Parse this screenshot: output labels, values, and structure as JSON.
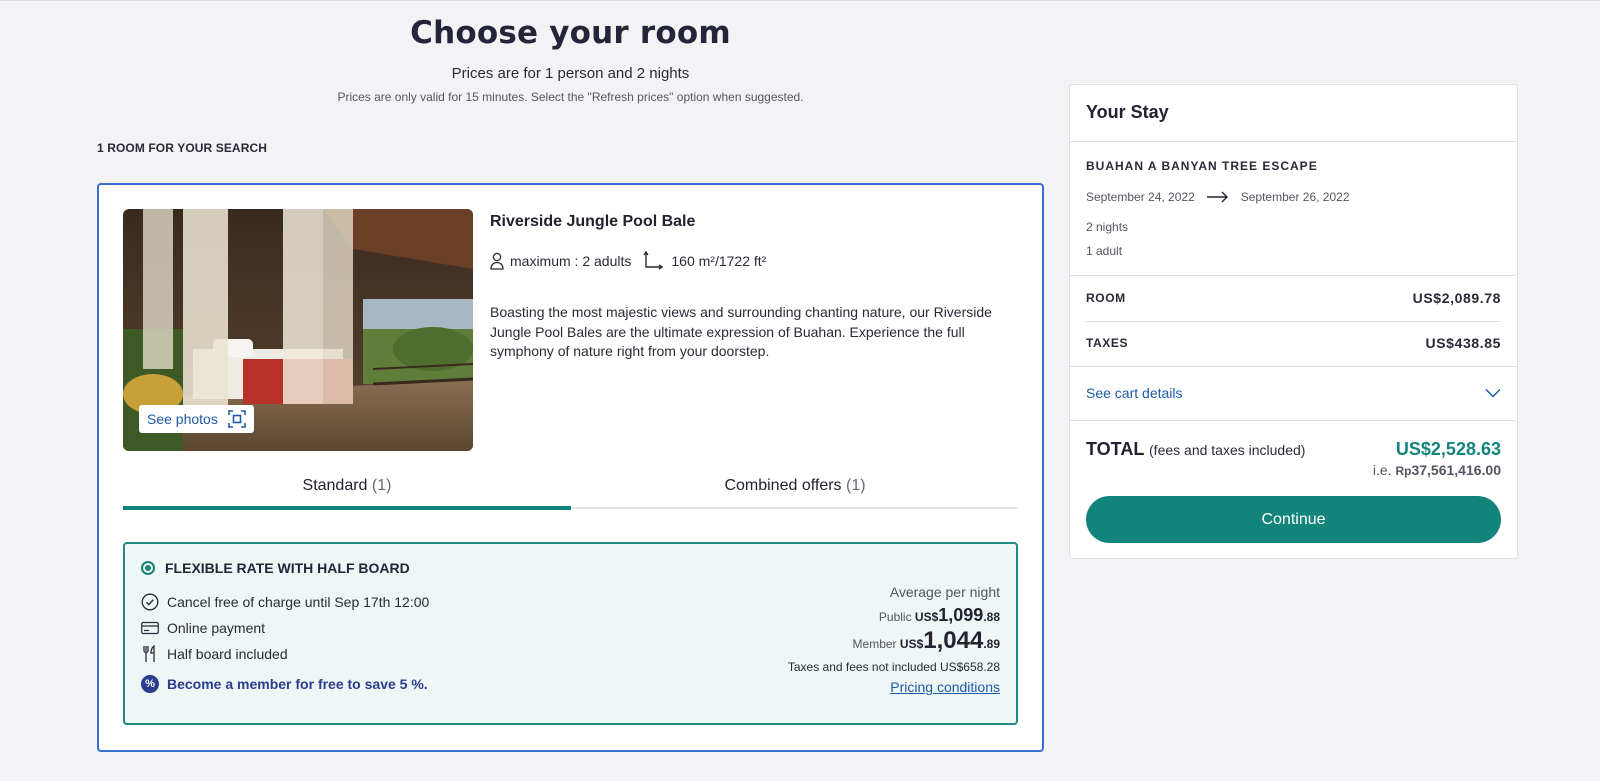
{
  "header": {
    "title": "Choose your room",
    "subtitle": "Prices are for 1 person and 2 nights",
    "notice": "Prices are only valid for 15 minutes. Select the \"Refresh prices\" option when suggested."
  },
  "results": {
    "count_label": "1 ROOM FOR YOUR SEARCH"
  },
  "room": {
    "see_photos": "See photos",
    "name": "Riverside Jungle Pool Bale",
    "capacity": "maximum : 2 adults",
    "area": "160 m²/1722 ft²",
    "description": "Boasting the most majestic views and surrounding chanting nature, our Riverside Jungle Pool Bales are the ultimate expression of Buahan. Experience the full symphony of nature right from your doorstep.",
    "tabs": [
      {
        "label": "Standard",
        "count": "(1)"
      },
      {
        "label": "Combined offers",
        "count": "(1)"
      }
    ],
    "rate": {
      "title": "FLEXIBLE RATE WITH HALF BOARD",
      "features": [
        {
          "icon": "check-circle-icon",
          "text": "Cancel free of charge until Sep 17th 12:00"
        },
        {
          "icon": "credit-card-icon",
          "text": "Online payment"
        },
        {
          "icon": "cutlery-icon",
          "text": "Half board included"
        }
      ],
      "member_promo": "Become a member for free to save 5 %.",
      "promo_symbol": "%",
      "avg_label": "Average per night",
      "public_label": "Public",
      "public_currency": "US$",
      "public_amount": "1,099",
      "public_cents": ".88",
      "member_label": "Member",
      "member_currency": "US$",
      "member_amount": "1,044",
      "member_cents": ".89",
      "taxes_note": "Taxes and fees not included US$658.28",
      "pricing_link": "Pricing conditions"
    }
  },
  "stay": {
    "title": "Your Stay",
    "hotel": "BUAHAN A BANYAN TREE ESCAPE",
    "check_in": "September 24, 2022",
    "check_out": "September 26, 2022",
    "nights": "2 nights",
    "guests": "1 adult",
    "room_label": "ROOM",
    "room_value": "US$2,089.78",
    "taxes_label": "TAXES",
    "taxes_value": "US$438.85",
    "cart_details": "See cart details",
    "total_label": "TOTAL",
    "total_included": "(fees and taxes included)",
    "total_value": "US$2,528.63",
    "local_prefix": "i.e.",
    "local_currency": "Rp",
    "local_value": "37,561,416.00",
    "continue": "Continue"
  },
  "colors": {
    "accent": "#12847c",
    "card_border": "#3a6ed0",
    "link": "#1d5aa8",
    "promo": "#2c3c8e"
  }
}
